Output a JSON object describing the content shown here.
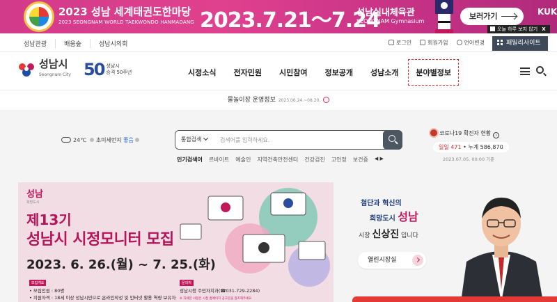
{
  "banner": {
    "title": "2023 성남 세계태권도한마당",
    "subtitle": "2023 SEONGNAM WORLD TAEKWONDO HANMADANG",
    "date": "2023.7.21～7.24",
    "venue": "성남실내체육관",
    "venue_en": "SEONGNAM Gymnasium",
    "view_button": "보러가기",
    "kuk": "KUK",
    "close_label": "오늘 하루 보지 않기",
    "close_x": "X"
  },
  "util": {
    "links": [
      "성남관광",
      "배움숲",
      "성남시의회"
    ],
    "login": "로그인",
    "signup": "회원가입",
    "language": "언어변경",
    "family_site": "패밀리사이트"
  },
  "header": {
    "logo_name": "성남시",
    "logo_en": "Seongnam City",
    "anniv_number": "50",
    "anniv_line1": "성남시",
    "anniv_line2": "승격 50주년",
    "nav": [
      "시정소식",
      "전자민원",
      "시민참여",
      "정보공개",
      "성남소개",
      "분야별정보"
    ]
  },
  "notice": {
    "text": "물놀이장 운영정보",
    "date": "2023.06.24.~08.20."
  },
  "weather": {
    "temp": "24℃",
    "dust_label": "초미세먼지",
    "dust_value": "좋음"
  },
  "search": {
    "category": "통합검색",
    "placeholder": "검색어를 입력하세요.",
    "popular_label": "인기검색어",
    "popular_items": [
      "르바이트",
      "예술인",
      "지역건축안전센터",
      "건강검진",
      "고인정",
      "보건증"
    ]
  },
  "covid": {
    "title": "코로나19 확진자 현황",
    "daily": "일일 471",
    "total": "누계 586,870",
    "date": "2023.07.05. 00:00 기준"
  },
  "promo": {
    "badge": "성남",
    "badge_small": "희망도시",
    "title1": "제13기",
    "title2": "성남시  시정모니터 모집",
    "period": "2023. 6. 26.(월) ~ 7. 25.(화)",
    "label_recruit": "모집개요",
    "recruit_count": "• 모집인원 : 80명",
    "recruit_qual": "• 지원자격 : 18세 이상 성남시민으로 온라인작성 및 인터넷 활용 역량 보유자",
    "label_contact": "문의처",
    "contact": "성남시청 주민자치과(☎031-729-2284)",
    "warn": "※ 자세한 사항은 시청 홈페이지 공고문을 참조해주세요"
  },
  "mayor": {
    "slogan_a": "첨단과 혁신의",
    "slogan_b": "희망도시",
    "slogan_city": "성남",
    "title_prefix": "시장",
    "name": "신상진",
    "title_suffix": "입니다",
    "open_button": "열린시장실"
  }
}
